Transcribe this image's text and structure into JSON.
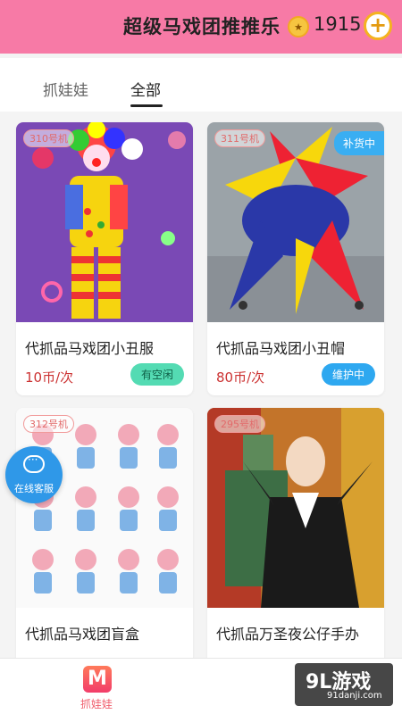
{
  "header": {
    "title": "超级马戏团推推乐",
    "coin_icon": "coin-icon",
    "coins": "1915",
    "add_label": "+"
  },
  "tabs": [
    {
      "label": "抓娃娃",
      "active": false
    },
    {
      "label": "全部",
      "active": true
    }
  ],
  "cards": [
    {
      "machine": "310号机",
      "name": "代抓品马戏团小丑服",
      "price": "10币/次",
      "status": "有空闲",
      "status_type": "free",
      "badge": ""
    },
    {
      "machine": "311号机",
      "name": "代抓品马戏团小丑帽",
      "price": "80币/次",
      "status": "维护中",
      "status_type": "maint",
      "badge": "补货中"
    },
    {
      "machine": "312号机",
      "name": "代抓品马戏团盲盒",
      "price": "",
      "status": "",
      "status_type": "free",
      "badge": ""
    },
    {
      "machine": "295号机",
      "name": "代抓品万圣夜公仔手办",
      "price": "",
      "status": "",
      "status_type": "free",
      "badge": ""
    }
  ],
  "customer_service": {
    "label": "在线客服",
    "icon": "chat-bubble-icon"
  },
  "bottom_nav": {
    "label": "抓娃娃",
    "icon": "m-logo-icon"
  },
  "watermark": {
    "main": "9L游戏",
    "sub": "91danji.com"
  }
}
